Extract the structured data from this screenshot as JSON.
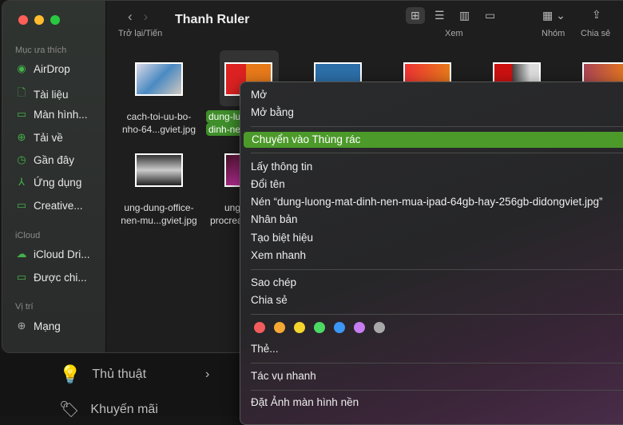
{
  "window": {
    "title": "Thanh Ruler",
    "back_forward_label": "Trở lại/Tiến",
    "view_label": "Xem",
    "group_label": "Nhóm",
    "share_label": "Chia sẻ"
  },
  "sidebar": {
    "favorites_header": "Mục ưa thích",
    "favorites": [
      {
        "label": "AirDrop",
        "icon": "airdrop-icon"
      },
      {
        "label": "Tài liệu",
        "icon": "document-icon"
      },
      {
        "label": "Màn hình...",
        "icon": "desktop-icon"
      },
      {
        "label": "Tải về",
        "icon": "download-icon"
      },
      {
        "label": "Gần đây",
        "icon": "clock-icon"
      },
      {
        "label": "Ứng dụng",
        "icon": "apps-icon"
      },
      {
        "label": "Creative...",
        "icon": "folder-icon"
      }
    ],
    "icloud_header": "iCloud",
    "icloud": [
      {
        "label": "iCloud Dri...",
        "icon": "cloud-icon"
      },
      {
        "label": "Được chi...",
        "icon": "shared-folder-icon"
      }
    ],
    "locations_header": "Vị trí",
    "locations": [
      {
        "label": "Mạng",
        "icon": "globe-icon"
      }
    ]
  },
  "files": [
    {
      "line1": "cach-toi-uu-bo-",
      "line2": "nho-64...gviet.jpg"
    },
    {
      "line1": "dung-lu",
      "line2": "dinh-ne",
      "selected": true
    },
    {
      "line1": "",
      "line2": ""
    },
    {
      "line1": "",
      "line2": ""
    },
    {
      "line1": "",
      "line2": ""
    },
    {
      "line1": "",
      "line2": ""
    },
    {
      "line1": "ung-dung-office-",
      "line2": "nen-mu...gviet.jpg"
    },
    {
      "line1": "ung",
      "line2": "procrea"
    }
  ],
  "context_menu": {
    "items": [
      "Mở",
      "Mở bằng",
      "Chuyển vào Thùng rác",
      "Lấy thông tin",
      "Đổi tên",
      "Nén “dung-luong-mat-dinh-nen-mua-ipad-64gb-hay-256gb-didongviet.jpg”",
      "Nhân bản",
      "Tạo biệt hiệu",
      "Xem nhanh",
      "Sao chép",
      "Chia sẻ",
      "Thẻ...",
      "Tác vụ nhanh",
      "Đặt Ảnh màn hình nền"
    ],
    "highlighted": "Chuyển vào Thùng rác",
    "tag_colors": [
      "#f25c5c",
      "#f5a833",
      "#f5d52c",
      "#4cd964",
      "#3b97f5",
      "#c77cf0",
      "#a8a8a8"
    ]
  },
  "background_site": {
    "items": [
      "Thủ thuật",
      "Khuyến mãi"
    ]
  },
  "colors": {
    "accent": "#4c9a2a"
  }
}
